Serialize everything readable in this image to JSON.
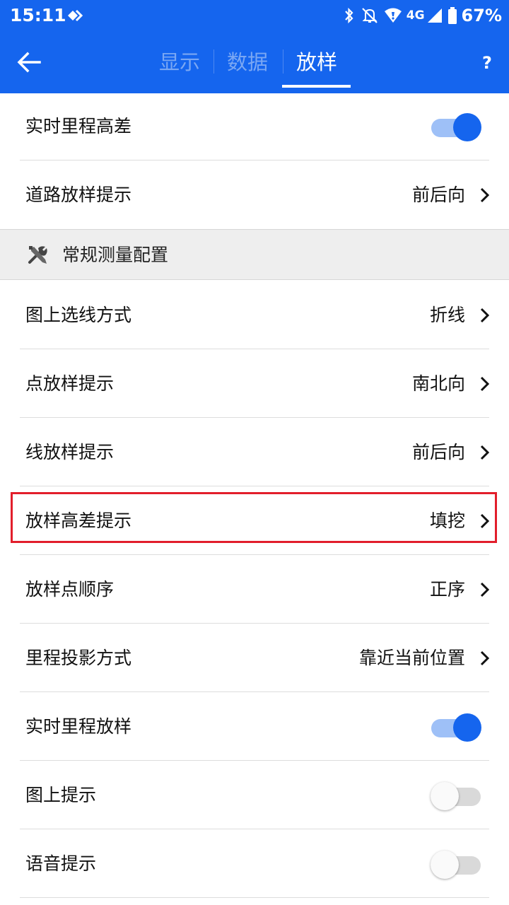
{
  "status_bar": {
    "time": "15:11",
    "network": "4G",
    "battery": "67%",
    "icons": [
      "diamond-icon",
      "bluetooth-icon",
      "mute-icon",
      "wifi-icon",
      "signal-icon",
      "battery-icon"
    ]
  },
  "app_bar": {
    "tabs": [
      {
        "label": "显示",
        "active": false
      },
      {
        "label": "数据",
        "active": false
      },
      {
        "label": "放样",
        "active": true
      }
    ],
    "help_label": "?"
  },
  "rows_top": [
    {
      "label": "实时里程高差",
      "type": "toggle",
      "on": true
    },
    {
      "label": "道路放样提示",
      "type": "value",
      "value": "前后向"
    }
  ],
  "section": {
    "label": "常规测量配置",
    "icon": "tools-icon"
  },
  "rows": [
    {
      "label": "图上选线方式",
      "type": "value",
      "value": "折线"
    },
    {
      "label": "点放样提示",
      "type": "value",
      "value": "南北向"
    },
    {
      "label": "线放样提示",
      "type": "value",
      "value": "前后向"
    },
    {
      "label": "放样高差提示",
      "type": "value",
      "value": "填挖",
      "highlighted": true
    },
    {
      "label": "放样点顺序",
      "type": "value",
      "value": "正序"
    },
    {
      "label": "里程投影方式",
      "type": "value",
      "value": "靠近当前位置"
    },
    {
      "label": "实时里程放样",
      "type": "toggle",
      "on": true
    },
    {
      "label": "图上提示",
      "type": "toggle",
      "on": false
    },
    {
      "label": "语音提示",
      "type": "toggle",
      "on": false
    }
  ],
  "colors": {
    "primary": "#1565ee",
    "highlight": "#e21e2b",
    "section_bg": "#eeeeee"
  }
}
